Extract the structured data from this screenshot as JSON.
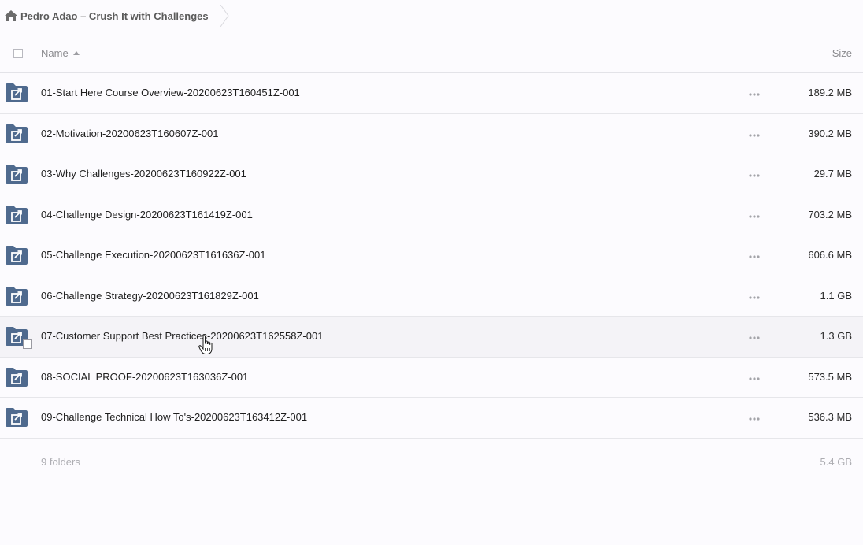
{
  "breadcrumb": {
    "title": "Pedro Adao – Crush It with Challenges"
  },
  "header": {
    "name_label": "Name",
    "size_label": "Size"
  },
  "rows": [
    {
      "name": "01-Start Here Course Overview-20200623T160451Z-001",
      "size": "189.2 MB"
    },
    {
      "name": "02-Motivation-20200623T160607Z-001",
      "size": "390.2 MB"
    },
    {
      "name": "03-Why Challenges-20200623T160922Z-001",
      "size": "29.7 MB"
    },
    {
      "name": "04-Challenge Design-20200623T161419Z-001",
      "size": "703.2 MB"
    },
    {
      "name": "05-Challenge Execution-20200623T161636Z-001",
      "size": "606.6 MB"
    },
    {
      "name": "06-Challenge Strategy-20200623T161829Z-001",
      "size": "1.1 GB"
    },
    {
      "name": "07-Customer Support Best Practices-20200623T162558Z-001",
      "size": "1.3 GB"
    },
    {
      "name": "08-SOCIAL PROOF-20200623T163036Z-001",
      "size": "573.5 MB"
    },
    {
      "name": "09-Challenge Technical How To's-20200623T163412Z-001",
      "size": "536.3 MB"
    }
  ],
  "footer": {
    "count": "9 folders",
    "total_size": "5.4 GB"
  },
  "colors": {
    "folder": "#4f6a8e",
    "background": "#fcfbfe",
    "hover_row": "#f4f3f7"
  },
  "icons": {
    "home": "home-icon",
    "folder": "shared-folder-icon",
    "more": "more-dots-icon",
    "sort": "sort-ascending-icon"
  }
}
